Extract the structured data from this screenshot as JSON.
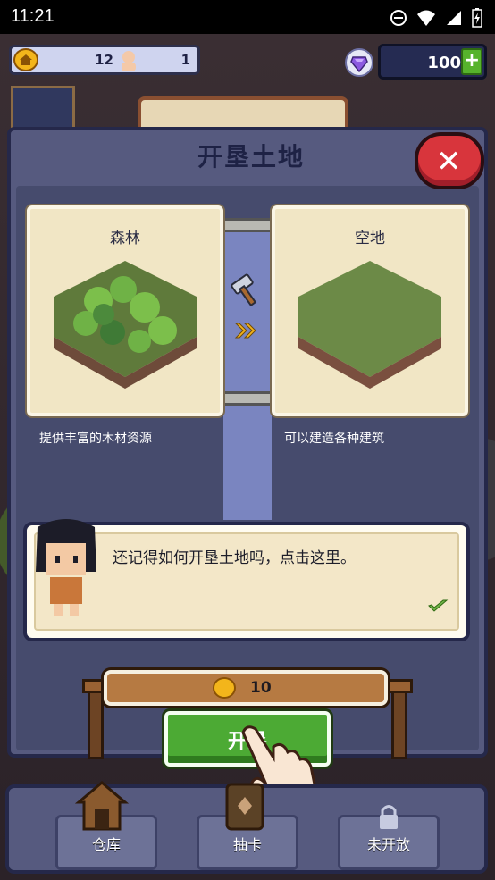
{
  "status_bar": {
    "time": "11:21",
    "icons": [
      "dnd-icon",
      "wifi-icon",
      "signal-icon",
      "battery-icon"
    ]
  },
  "hud": {
    "gold": "12",
    "population": "1",
    "gems": "100",
    "plus_label": "+"
  },
  "panel": {
    "title": "开垦土地",
    "close_label": "✕",
    "from_tile": {
      "label": "森林",
      "description": "提供丰富的木材资源"
    },
    "to_tile": {
      "label": "空地",
      "description": "可以建造各种建筑"
    },
    "dialogue": "还记得如何开垦土地吗，点击这里。",
    "cost": "10",
    "action_label": "开垦"
  },
  "nav": {
    "items": [
      {
        "label": "仓库"
      },
      {
        "label": "抽卡"
      },
      {
        "label": "未开放"
      }
    ]
  },
  "colors": {
    "panel_bg": "#565a7f",
    "card_bg": "#f1e6c5",
    "close_red": "#d8353c",
    "button_green": "#4caa34",
    "gold": "#f3b51b"
  }
}
